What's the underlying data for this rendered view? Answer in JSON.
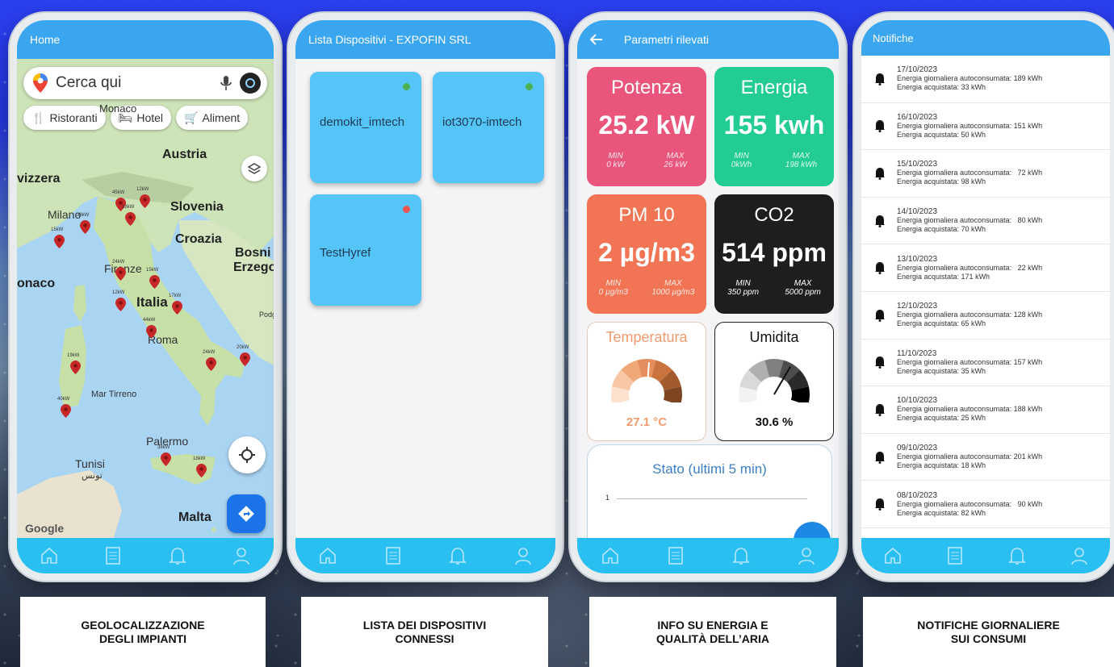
{
  "colors": {
    "appbar": "#3ba6f0",
    "bottombar": "#29bff0",
    "device_card": "#55c4f7",
    "potenza": "#e9557b",
    "energia": "#22cc93",
    "pm10": "#f17555",
    "co2": "#1e1e1e",
    "online": "#4caf50",
    "offline": "#ef5350"
  },
  "bottom_nav": [
    "home-icon",
    "document-icon",
    "bell-icon",
    "user-icon"
  ],
  "map_screen": {
    "title": "Home",
    "search_placeholder": "Cerca qui",
    "chips": [
      "Ristoranti",
      "Hotel",
      "Aliment"
    ],
    "labels": {
      "monaco": "Monaco",
      "austria": "Austria",
      "svizzera": "vizzera",
      "slovenia": "Slovenia",
      "milano": "Milano",
      "croazia": "Croazia",
      "bosnia": "Bosni",
      "erzego": "Erzego",
      "firenze": "Firenze",
      "naco": "onaco",
      "italia": "Italia",
      "roma": "Roma",
      "podg": "Podg",
      "mar_tirreno": "Mar Tirreno",
      "palermo": "Palermo",
      "tunisi": "Tunisi",
      "tunisi_ar": "تونس",
      "malta": "Malta",
      "google": "Google"
    },
    "pin_labels": [
      "45kW",
      "12kW",
      "18kW",
      "38kW",
      "15kW",
      "24kW",
      "15kW",
      "12kW",
      "17kW",
      "44kW",
      "24kW",
      "20kW",
      "19kW",
      "40kW",
      "38kW",
      "18kW"
    ]
  },
  "devices_screen": {
    "title": "Lista Dispositivi - EXPOFIN SRL",
    "devices": [
      {
        "name": "demokit_imtech",
        "status": "online"
      },
      {
        "name": "iot3070-imtech",
        "status": "online"
      },
      {
        "name": "TestHyref",
        "status": "offline"
      }
    ]
  },
  "params_screen": {
    "title": "Parametri rilevati",
    "cards": [
      {
        "title": "Potenza",
        "value": "25.2 kW",
        "min_label": "MIN",
        "min": "0 kW",
        "max_label": "MAX",
        "max": "26 kW"
      },
      {
        "title": "Energia",
        "value": "155 kwh",
        "min_label": "MIN",
        "min": "0kWh",
        "max_label": "MAX",
        "max": "198 kWh"
      },
      {
        "title": "PM 10",
        "value": "2 µg/m3",
        "min_label": "MIN",
        "min": "0 µg/m3",
        "max_label": "MAX",
        "max": "1000 µg/m3"
      },
      {
        "title": "CO2",
        "value": "514 ppm",
        "min_label": "MIN",
        "min": "350 ppm",
        "max_label": "MAX",
        "max": "5000 ppm"
      }
    ],
    "gauges": [
      {
        "title": "Temperatura",
        "value": "27.1 °C",
        "level": 0.52
      },
      {
        "title": "Umidita",
        "value": "30.6 %",
        "level": 0.64
      }
    ],
    "status": {
      "title": "Stato (ultimi 5 min)",
      "y_tick": "1"
    }
  },
  "notif_screen": {
    "title": "Notifiche",
    "items": [
      {
        "date": "17/10/2023",
        "line1": "Energia giornaliera autoconsumata: 189 kWh",
        "line2": "Energia acquistata: 33 kWh"
      },
      {
        "date": "16/10/2023",
        "line1": "Energia giornaliera autoconsumata: 151 kWh",
        "line2": "Energia acquistata: 50 kWh"
      },
      {
        "date": "15/10/2023",
        "line1": "Energia giornaliera autoconsumata:   72 kWh",
        "line2": "Energia acquistata: 98 kWh"
      },
      {
        "date": "14/10/2023",
        "line1": "Energia giornaliera autoconsumata:   80 kWh",
        "line2": "Energia acquistata: 70 kWh"
      },
      {
        "date": "13/10/2023",
        "line1": "Energia giornaliera autoconsumata:   22 kWh",
        "line2": "Energia acquistata: 171 kWh"
      },
      {
        "date": "12/10/2023",
        "line1": "Energia giornaliera autoconsumata: 128 kWh",
        "line2": "Energia acquistata: 65 kWh"
      },
      {
        "date": "11/10/2023",
        "line1": "Energia giornaliera autoconsumata: 157 kWh",
        "line2": "Energia acquistata: 35 kWh"
      },
      {
        "date": "10/10/2023",
        "line1": "Energia giornaliera autoconsumata: 188 kWh",
        "line2": "Energia acquistata: 25 kWh"
      },
      {
        "date": "09/10/2023",
        "line1": "Energia giornaliera autoconsumata: 201 kWh",
        "line2": "Energia acquistata: 18 kWh"
      },
      {
        "date": "08/10/2023",
        "line1": "Energia giornaliera autoconsumata:   90 kWh",
        "line2": "Energia acquistata: 82 kWh"
      }
    ]
  },
  "captions": [
    {
      "line1": "GEOLOCALIZZAZIONE",
      "line2": "DEGLI IMPIANTI"
    },
    {
      "line1": "LISTA DEI DISPOSITIVI",
      "line2": "CONNESSI"
    },
    {
      "line1": "INFO SU ENERGIA E",
      "line2": "QUALITÀ DELL’ARIA"
    },
    {
      "line1": "NOTIFICHE GIORNALIERE",
      "line2": "SUI CONSUMI"
    }
  ]
}
